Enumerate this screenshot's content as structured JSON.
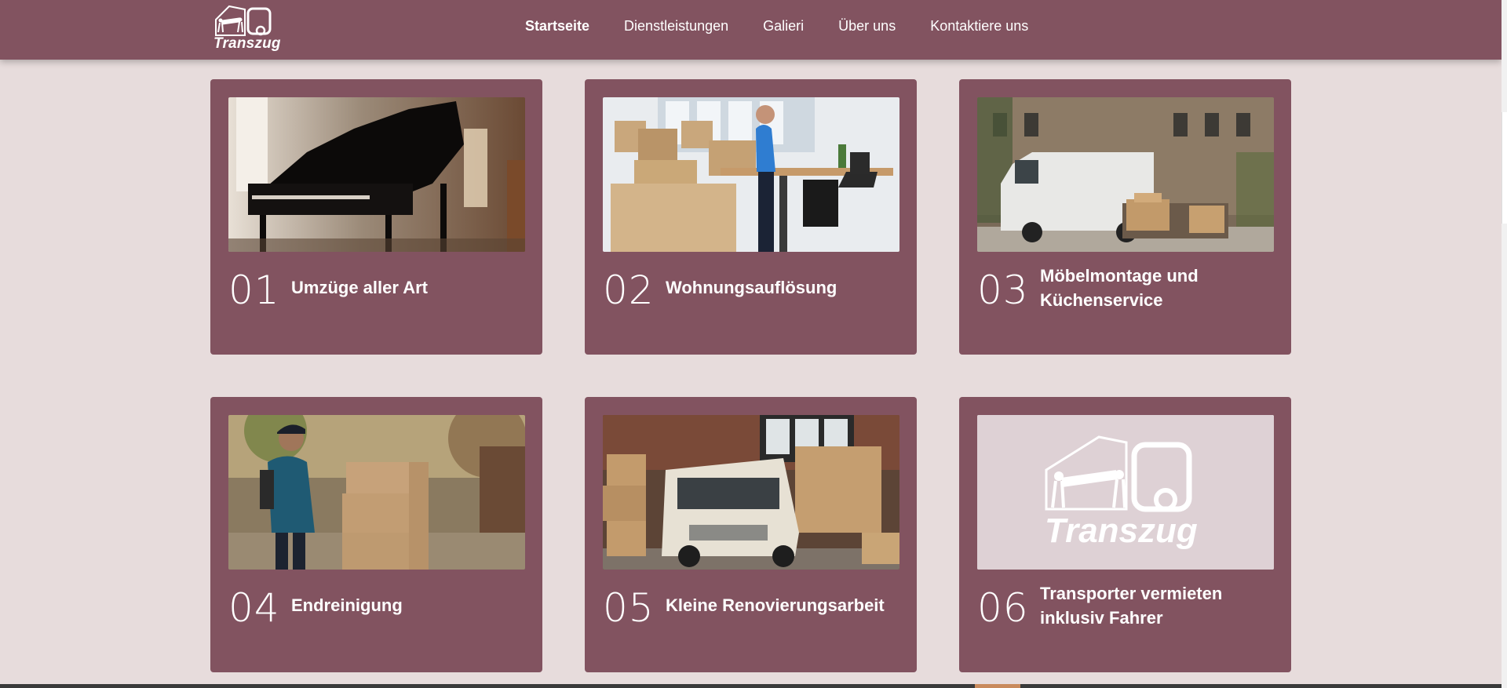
{
  "header": {
    "logo_text": "Transzug",
    "nav": [
      "Startseite",
      "Dienstleistungen",
      "Galieri",
      "Über uns",
      "Kontaktiere uns"
    ]
  },
  "cards": [
    {
      "number": "01",
      "title": "Umzüge aller Art",
      "image": "grand-piano-photo"
    },
    {
      "number": "02",
      "title": "Wohnungsauflösung",
      "image": "office-moving-boxes-photo"
    },
    {
      "number": "03",
      "title": "Möbelmontage und Küchenservice",
      "image": "white-van-with-boxes-photo"
    },
    {
      "number": "04",
      "title": "Endreinigung",
      "image": "man-with-boxes-photo"
    },
    {
      "number": "05",
      "title": "Kleine Renovierungsarbeit",
      "image": "truck-loaded-boxes-photo"
    },
    {
      "number": "06",
      "title": "Transporter vermieten inklusiv Fahrer",
      "image": "transzug-logo-placeholder"
    }
  ],
  "colors": {
    "brand": "#825360",
    "background": "#e7dcdc"
  }
}
